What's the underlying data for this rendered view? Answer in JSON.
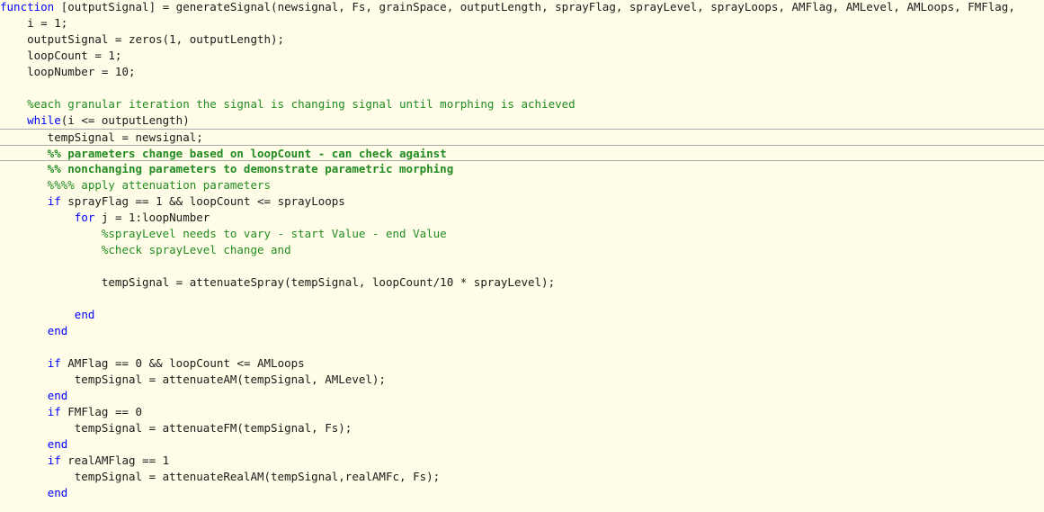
{
  "colors": {
    "background": "#fffde7",
    "keyword": "#0000ff",
    "comment": "#228b22",
    "text": "#1a1a1a",
    "cell_divider": "#a9a9a9"
  },
  "lines": [
    {
      "segments": [
        {
          "text": "function",
          "style": "kw"
        },
        {
          "text": " [outputSignal] = generateSignal(newsignal, Fs, grainSpace, outputLength, sprayFlag, sprayLevel, sprayLoops, AMFlag, AMLevel, AMLoops, FMFlag,",
          "style": "code"
        }
      ]
    },
    {
      "segments": [
        {
          "text": "    i = 1;",
          "style": "code"
        }
      ]
    },
    {
      "segments": [
        {
          "text": "    outputSignal = zeros(1, outputLength);",
          "style": "code"
        }
      ]
    },
    {
      "segments": [
        {
          "text": "    loopCount = 1;",
          "style": "code"
        }
      ]
    },
    {
      "segments": [
        {
          "text": "    loopNumber = 10;",
          "style": "code"
        }
      ]
    },
    {
      "segments": []
    },
    {
      "segments": [
        {
          "text": "    %each granular iteration the signal is changing signal until morphing is achieved",
          "style": "cm"
        }
      ]
    },
    {
      "segments": [
        {
          "text": "    ",
          "style": "code"
        },
        {
          "text": "while",
          "style": "kw"
        },
        {
          "text": "(i <= outputLength)",
          "style": "code"
        }
      ]
    },
    {
      "segments": [
        {
          "text": "       tempSignal = newsignal;",
          "style": "code"
        }
      ],
      "cell": "start"
    },
    {
      "segments": [
        {
          "text": "       %% parameters change based on loopCount - can check against",
          "style": "cmb"
        }
      ],
      "cell": "start end"
    },
    {
      "segments": [
        {
          "text": "       %% nonchanging parameters to demonstrate parametric morphing",
          "style": "cmb"
        }
      ]
    },
    {
      "segments": [
        {
          "text": "       %%%% apply attenuation parameters",
          "style": "cm"
        }
      ]
    },
    {
      "segments": [
        {
          "text": "       ",
          "style": "code"
        },
        {
          "text": "if",
          "style": "kw"
        },
        {
          "text": " sprayFlag == 1 && loopCount <= sprayLoops",
          "style": "code"
        }
      ]
    },
    {
      "segments": [
        {
          "text": "           ",
          "style": "code"
        },
        {
          "text": "for",
          "style": "kw"
        },
        {
          "text": " j = 1:loopNumber",
          "style": "code"
        }
      ]
    },
    {
      "segments": [
        {
          "text": "               %sprayLevel needs to vary - start Value - end Value",
          "style": "cm"
        }
      ]
    },
    {
      "segments": [
        {
          "text": "               %check sprayLevel change and",
          "style": "cm"
        }
      ]
    },
    {
      "segments": []
    },
    {
      "segments": [
        {
          "text": "               tempSignal = attenuateSpray(tempSignal, loopCount/10 * sprayLevel);",
          "style": "code"
        }
      ]
    },
    {
      "segments": []
    },
    {
      "segments": [
        {
          "text": "           ",
          "style": "code"
        },
        {
          "text": "end",
          "style": "kw"
        }
      ]
    },
    {
      "segments": [
        {
          "text": "       ",
          "style": "code"
        },
        {
          "text": "end",
          "style": "kw"
        }
      ]
    },
    {
      "segments": []
    },
    {
      "segments": [
        {
          "text": "       ",
          "style": "code"
        },
        {
          "text": "if",
          "style": "kw"
        },
        {
          "text": " AMFlag == 0 && loopCount <= AMLoops",
          "style": "code"
        }
      ]
    },
    {
      "segments": [
        {
          "text": "           tempSignal = attenuateAM(tempSignal, AMLevel);",
          "style": "code"
        }
      ]
    },
    {
      "segments": [
        {
          "text": "       ",
          "style": "code"
        },
        {
          "text": "end",
          "style": "kw"
        }
      ]
    },
    {
      "segments": [
        {
          "text": "       ",
          "style": "code"
        },
        {
          "text": "if",
          "style": "kw"
        },
        {
          "text": " FMFlag == 0",
          "style": "code"
        }
      ]
    },
    {
      "segments": [
        {
          "text": "           tempSignal = attenuateFM(tempSignal, Fs);",
          "style": "code"
        }
      ]
    },
    {
      "segments": [
        {
          "text": "       ",
          "style": "code"
        },
        {
          "text": "end",
          "style": "kw"
        }
      ]
    },
    {
      "segments": [
        {
          "text": "       ",
          "style": "code"
        },
        {
          "text": "if",
          "style": "kw"
        },
        {
          "text": " realAMFlag == 1",
          "style": "code"
        }
      ]
    },
    {
      "segments": [
        {
          "text": "           tempSignal = attenuateRealAM(tempSignal,realAMFc, Fs);",
          "style": "code"
        }
      ]
    },
    {
      "segments": [
        {
          "text": "       ",
          "style": "code"
        },
        {
          "text": "end",
          "style": "kw"
        }
      ]
    }
  ]
}
